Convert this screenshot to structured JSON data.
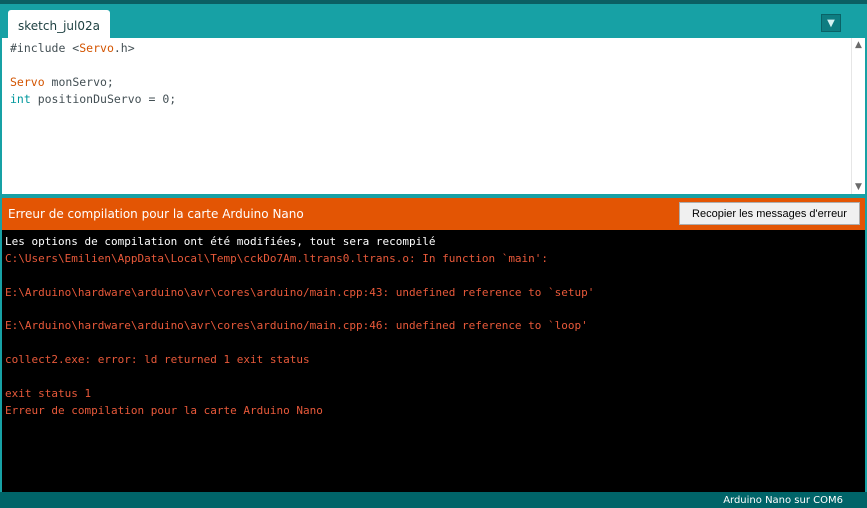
{
  "tab": {
    "label": "sketch_jul02a"
  },
  "editor": {
    "lines": [
      {
        "parts": [
          {
            "text": "#include <",
            "style": "plain"
          },
          {
            "text": "Servo",
            "style": "orange"
          },
          {
            "text": ".h>",
            "style": "plain"
          }
        ]
      },
      {
        "parts": []
      },
      {
        "parts": [
          {
            "text": "Servo",
            "style": "orange"
          },
          {
            "text": " monServo;",
            "style": "plain"
          }
        ]
      },
      {
        "parts": [
          {
            "text": "int",
            "style": "teal"
          },
          {
            "text": " positionDuServo = 0;",
            "style": "plain"
          }
        ]
      }
    ]
  },
  "error_bar": {
    "message": "Erreur de compilation pour la carte Arduino Nano",
    "copy_button": "Recopier les messages d'erreur"
  },
  "console": {
    "lines": [
      {
        "text": "Les options de compilation ont été modifiées, tout sera recompilé",
        "kind": "white"
      },
      {
        "text": "C:\\Users\\Emilien\\AppData\\Local\\Temp\\cckDo7Am.ltrans0.ltrans.o: In function `main':",
        "kind": "err"
      },
      {
        "text": "",
        "kind": "err"
      },
      {
        "text": "E:\\Arduino\\hardware\\arduino\\avr\\cores\\arduino/main.cpp:43: undefined reference to `setup'",
        "kind": "err"
      },
      {
        "text": "",
        "kind": "err"
      },
      {
        "text": "E:\\Arduino\\hardware\\arduino\\avr\\cores\\arduino/main.cpp:46: undefined reference to `loop'",
        "kind": "err"
      },
      {
        "text": "",
        "kind": "err"
      },
      {
        "text": "collect2.exe: error: ld returned 1 exit status",
        "kind": "err"
      },
      {
        "text": "",
        "kind": "err"
      },
      {
        "text": "exit status 1",
        "kind": "err"
      },
      {
        "text": "Erreur de compilation pour la carte Arduino Nano",
        "kind": "err"
      }
    ]
  },
  "status": {
    "board": "Arduino Nano sur COM6"
  },
  "icons": {
    "tab_menu": "chevron-down-icon",
    "scroll_up": "arrow-up-icon",
    "scroll_down": "arrow-down-icon"
  },
  "colors": {
    "accent": "#17a1a5",
    "error_bar": "#e35504",
    "console_bg": "#000000",
    "status_bar": "#006468"
  }
}
